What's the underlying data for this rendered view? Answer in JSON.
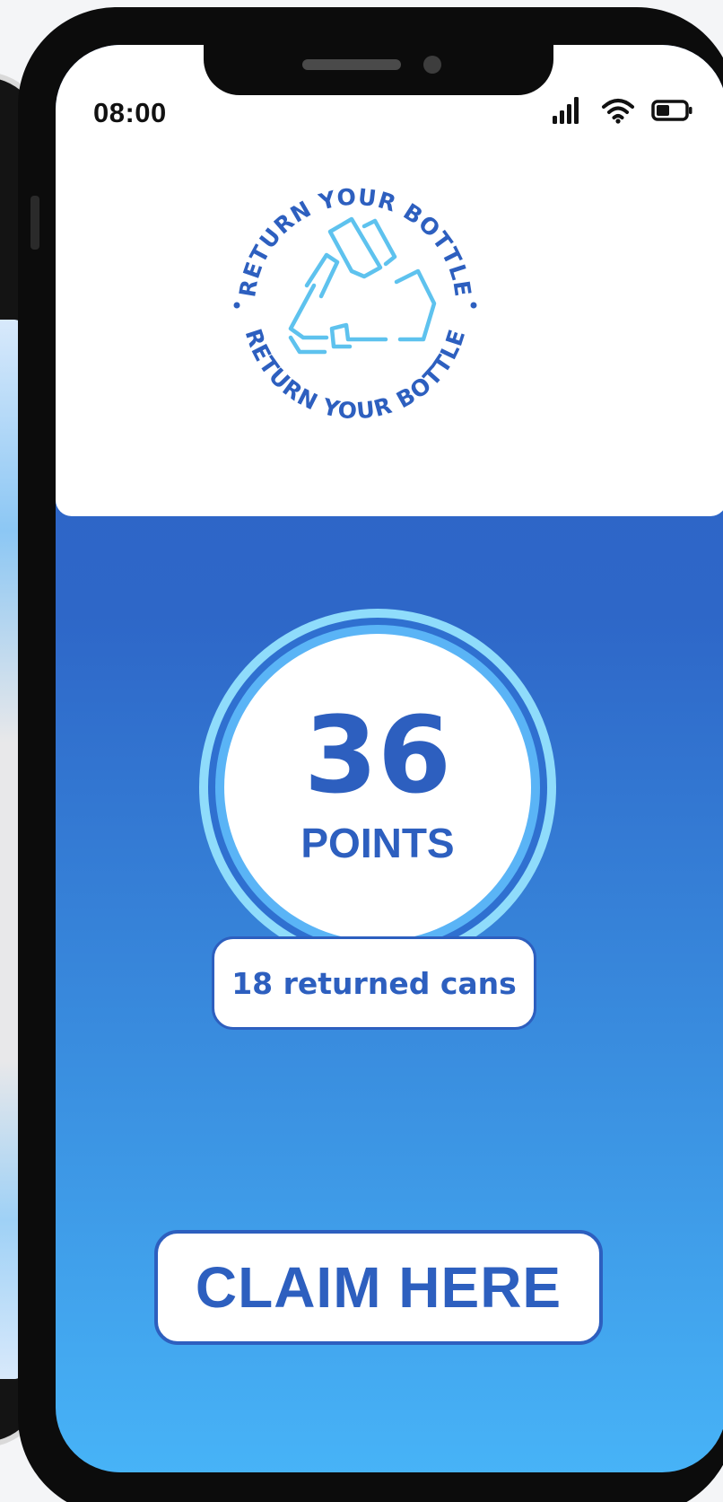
{
  "status_bar": {
    "time": "08:00",
    "icons": [
      "signal-icon",
      "wifi-icon",
      "battery-icon"
    ]
  },
  "logo": {
    "ring_text_top": "RETURN YOUR BOTTLE",
    "ring_text_bottom": "RETURN YOUR BOTTLE",
    "icon": "recycle-bottles-icon"
  },
  "points": {
    "value": "36",
    "label": "POINTS",
    "returned": "18 returned cans"
  },
  "actions": {
    "claim_label": "CLAIM HERE"
  },
  "colors": {
    "primary_blue": "#2d5fbf",
    "light_blue": "#47b3f7",
    "ring_cyan": "#8fdcfb",
    "logo_cyan": "#5ec2ee",
    "white": "#ffffff"
  }
}
